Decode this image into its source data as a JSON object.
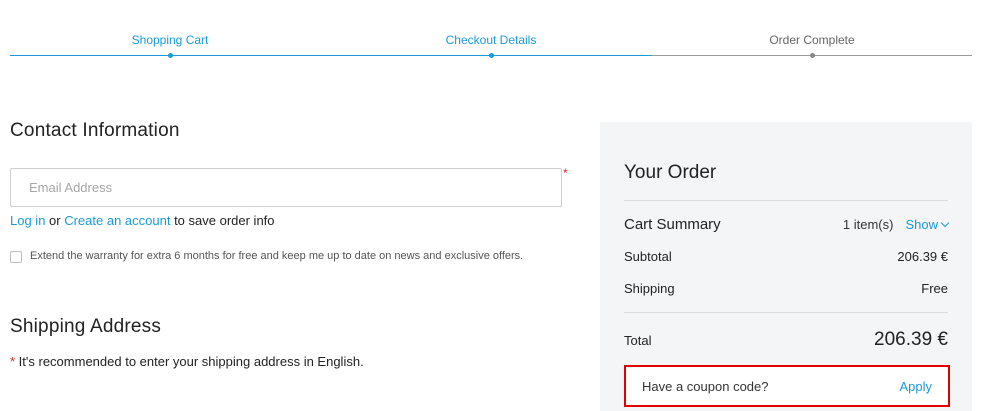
{
  "steps": [
    {
      "label": "Shopping Cart",
      "state": "active"
    },
    {
      "label": "Checkout Details",
      "state": "active"
    },
    {
      "label": "Order Complete",
      "state": "inactive"
    }
  ],
  "contact": {
    "title": "Contact Information",
    "email_placeholder": "Email Address",
    "required_mark": "*",
    "login_link": "Log in",
    "or_text": " or ",
    "create_link": "Create an account",
    "save_text": " to save order info",
    "warranty_text": "Extend the warranty for extra 6 months for free and keep me up to date on news and exclusive offers."
  },
  "shipping": {
    "title": "Shipping Address",
    "note_star": "*",
    "note_text": " It's recommended to enter your shipping address in English."
  },
  "order": {
    "title": "Your Order",
    "cart_summary_label": "Cart Summary",
    "items_count": "1 item(s)",
    "show_label": "Show",
    "subtotal_label": "Subtotal",
    "subtotal_value": "206.39 €",
    "shipping_label": "Shipping",
    "shipping_value": "Free",
    "total_label": "Total",
    "total_value": "206.39 €",
    "coupon_question": "Have a coupon code?",
    "apply_label": "Apply"
  },
  "colors": {
    "accent": "#1a9bd7",
    "highlight_border": "#e00000",
    "summary_bg": "#f4f5f6"
  }
}
